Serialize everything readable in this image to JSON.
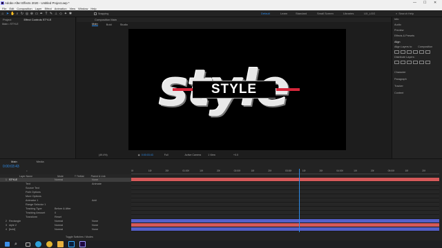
{
  "window": {
    "title": "Adobe After Effects 2020 - Untitled Project.aep *",
    "minimize": "—",
    "maximize": "☐",
    "close": "✕"
  },
  "menu": [
    "File",
    "Edit",
    "Composition",
    "Layer",
    "Effect",
    "Animation",
    "View",
    "Window",
    "Help"
  ],
  "toolbar": {
    "snapping": "Snapping",
    "workspaces": [
      "Default",
      "Learn",
      "Standard",
      "Small Screen",
      "Libraries",
      "UX_LGG"
    ],
    "active_workspace": "Default",
    "search_placeholder": "Search Help"
  },
  "left_panel": {
    "tabs": [
      "Project",
      "Effect Controls STYLE"
    ],
    "subheader": "Main • STYLE"
  },
  "comp_panel": {
    "tab": "Composition Main",
    "subtabs": [
      "Main",
      "Bold",
      "Studio"
    ],
    "viewer_text": "STYLE",
    "bg_word": "style",
    "zoom": "(49.4%)",
    "time": "0:00:03:43",
    "resolution": "Full",
    "camera": "Active Camera",
    "views": "1 View",
    "exposure": "+0.0"
  },
  "right_panel": {
    "sections": [
      "Info",
      "Audio",
      "Preview",
      "Effects & Presets",
      "Align",
      "Character",
      "Paragraph",
      "Tracker",
      "Content"
    ],
    "align_to_label": "Align Layers to:",
    "align_to_value": "Composition",
    "distribute_label": "Distribute Layers:"
  },
  "timeline": {
    "tabs": [
      "Main",
      "Media"
    ],
    "current_time": "0:00:03:43",
    "column_headers": [
      "Layer Name",
      "Mode",
      "T TrkMat",
      "Parent & Link"
    ],
    "layers": [
      {
        "num": "1",
        "name": "STYLE",
        "mode": "Normal",
        "parent": "None",
        "selected": true
      },
      {
        "num": "",
        "name": "Text",
        "mode": "",
        "parent": "Animate"
      },
      {
        "num": "",
        "name": "Source Text",
        "mode": "",
        "parent": ""
      },
      {
        "num": "",
        "name": "Path Options",
        "mode": "",
        "parent": ""
      },
      {
        "num": "",
        "name": "More Options",
        "mode": "",
        "parent": ""
      },
      {
        "num": "",
        "name": "Animator 1",
        "mode": "",
        "parent": "Add"
      },
      {
        "num": "",
        "name": "Range Selector 1",
        "mode": "",
        "parent": ""
      },
      {
        "num": "",
        "name": "Tracking Type",
        "mode": "Before & After",
        "parent": ""
      },
      {
        "num": "",
        "name": "Tracking Amount",
        "mode": "0",
        "parent": ""
      },
      {
        "num": "",
        "name": "Transform",
        "mode": "Reset",
        "parent": ""
      },
      {
        "num": "2",
        "name": "Rectangle",
        "mode": "Normal",
        "parent": "None"
      },
      {
        "num": "3",
        "name": "style 2",
        "mode": "Normal",
        "parent": "None"
      },
      {
        "num": "4",
        "name": "[bold]",
        "mode": "Normal",
        "parent": "None"
      }
    ],
    "ruler": [
      "0f",
      "10f",
      "20f",
      "01:00f",
      "10f",
      "20f",
      "02:00f",
      "10f",
      "20f",
      "03:00f",
      "10f",
      "20f",
      "04:00f",
      "10f",
      "20f",
      "05:00f",
      "10f",
      "20f"
    ],
    "toggle_label": "Toggle Switches / Modes",
    "playhead_progress": 0.545
  },
  "colors": {
    "accent": "#2d8ceb",
    "text_layer_track": "#d55959",
    "shape_layer_track": "#5560c9",
    "red_bar": "#d6263a"
  }
}
